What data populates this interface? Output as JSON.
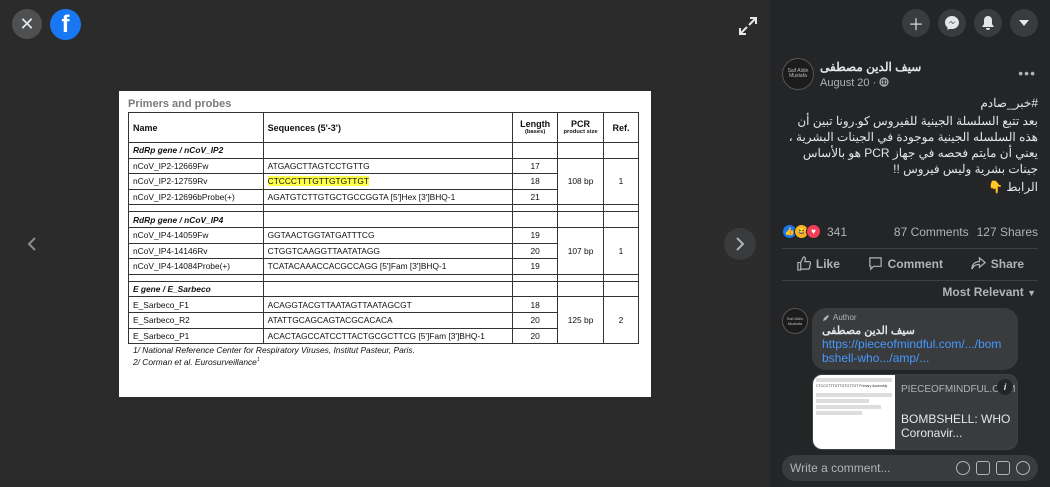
{
  "viewer": {
    "brand_letter": "f",
    "photo": {
      "title": "Primers and probes",
      "headers": {
        "name": "Name",
        "sequence": "Sequences (5'-3')",
        "length": "Length",
        "length_sub": "(bases)",
        "pcr": "PCR",
        "pcr_sub": "product size",
        "ref": "Ref."
      },
      "groups": [
        {
          "gene": "RdRp gene / nCoV_IP2",
          "rows": [
            {
              "name": "nCoV_IP2-12669Fw",
              "seq": "ATGAGCTTAGTCCTGTTG",
              "len": "17",
              "highlight": false
            },
            {
              "name": "nCoV_IP2-12759Rv",
              "seq": "CTCCCTTTGTTGTGTTGT",
              "len": "18",
              "highlight": true
            },
            {
              "name": "nCoV_IP2-12696bProbe(+)",
              "seq": "AGATGTCTTGTGCTGCCGGTA [5']Hex [3']BHQ-1",
              "len": "21",
              "highlight": false
            }
          ],
          "pcr": "108 bp",
          "ref": "1"
        },
        {
          "gene": "RdRp gene / nCoV_IP4",
          "rows": [
            {
              "name": "nCoV_IP4-14059Fw",
              "seq": "GGTAACTGGTATGATTTCG",
              "len": "19",
              "highlight": false
            },
            {
              "name": "nCoV_IP4-14146Rv",
              "seq": "CTGGTCAAGGTTAATATAGG",
              "len": "20",
              "highlight": false
            },
            {
              "name": "nCoV_IP4-14084Probe(+)",
              "seq": "TCATACAAACCACGCCAGG [5']Fam [3']BHQ-1",
              "len": "19",
              "highlight": false
            }
          ],
          "pcr": "107 bp",
          "ref": "1"
        },
        {
          "gene": "E gene / E_Sarbeco",
          "rows": [
            {
              "name": "E_Sarbeco_F1",
              "seq": "ACAGGTACGTTAATAGTTAATAGCGT",
              "len": "18",
              "highlight": false
            },
            {
              "name": "E_Sarbeco_R2",
              "seq": "ATATTGCAGCAGTACGCACACA",
              "len": "20",
              "highlight": false
            },
            {
              "name": "E_Sarbeco_P1",
              "seq": "ACACTAGCCATCCTTACTGCGCTTCG [5']Fam [3']BHQ-1",
              "len": "20",
              "highlight": false
            }
          ],
          "pcr": "125 bp",
          "ref": "2"
        }
      ],
      "footnotes": [
        "1/ National Reference Center for Respiratory Viruses, Institut Pasteur, Paris.",
        "2/ Corman et al. Eurosurveillance"
      ],
      "footnote2_sup": "1"
    }
  },
  "post": {
    "author": "سيف الدين مصطفى",
    "avatar_text": "Saif Aldin Mustafa",
    "date": "August 20 · ",
    "text_lines": [
      "#خبر_صادم",
      "بعد تتبع السلسلة الجينية للفيروس كو.رونا تبين أن هذه السلسله الجينية موجودة في الجينات البشرية ، يعني أن مايتم فحصه في جهاز PCR هو بالأساس جينات بشرية وليس فيروس !!",
      "الرابط 👇"
    ],
    "reaction_count": "341",
    "comments_count": "87 Comments",
    "shares_count": "127 Shares",
    "actions": {
      "like": "Like",
      "comment": "Comment",
      "share": "Share"
    },
    "sort_label": "Most Relevant",
    "comment": {
      "badge": "Author",
      "author": "سيف الدين مصطفى",
      "link_text": "https://pieceofmindful.com/.../bombshell-who.../amp/...",
      "card_domain": "PIECEOFMINDFUL.COM",
      "card_title": "BOMBSHELL: WHO Coronavir...",
      "thumb_text": "CTCCCTTTGTTGTGTTGT Primary Assembly"
    },
    "write_placeholder": "Write a comment..."
  }
}
